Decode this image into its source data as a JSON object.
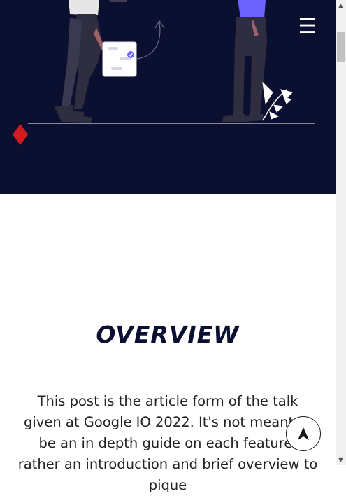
{
  "header": {
    "menu_icon": "hamburger-menu-icon",
    "menu_glyph": "☰"
  },
  "hero": {
    "background": "#0c1030",
    "accent_purple": "#6c63ff",
    "diamond_color": "#d01c1c",
    "illustration": "two-people-with-task-card"
  },
  "main": {
    "section_title": "OVERVIEW",
    "intro_text": "This post is the article form of the talk given at Google IO 2022. It's not meant to be an in depth guide on each feature, rather an introduction and brief overview to pique"
  },
  "scroll_to_top": {
    "icon": "navigation-arrow-icon"
  },
  "scrollbar": {
    "up_glyph": "▲",
    "down_glyph": "▼"
  }
}
